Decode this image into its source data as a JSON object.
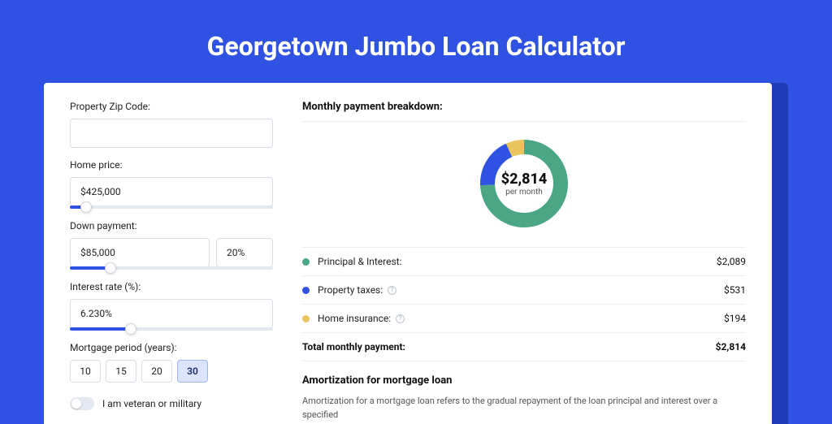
{
  "title": "Georgetown Jumbo Loan Calculator",
  "form": {
    "zip": {
      "label": "Property Zip Code:",
      "value": ""
    },
    "home_price": {
      "label": "Home price:",
      "value": "$425,000",
      "slider_pct": 8
    },
    "down_payment": {
      "label": "Down payment:",
      "amount": "$85,000",
      "percent": "20%",
      "slider_pct": 20
    },
    "interest_rate": {
      "label": "Interest rate (%):",
      "value": "6.230%",
      "slider_pct": 30
    },
    "period": {
      "label": "Mortgage period (years):",
      "options": [
        "10",
        "15",
        "20",
        "30"
      ],
      "active_index": 3
    },
    "veteran": {
      "label": "I am veteran or military",
      "checked": false
    }
  },
  "breakdown": {
    "title": "Monthly payment breakdown:",
    "donut_value": "$2,814",
    "donut_sub": "per month",
    "rows": [
      {
        "label": "Principal & Interest:",
        "amount": "$2,089",
        "color": "#4aa684",
        "info": false
      },
      {
        "label": "Property taxes:",
        "amount": "$531",
        "color": "#3052e3",
        "info": true
      },
      {
        "label": "Home insurance:",
        "amount": "$194",
        "color": "#e9c35b",
        "info": true
      }
    ],
    "total": {
      "label": "Total monthly payment:",
      "amount": "$2,814"
    }
  },
  "amort": {
    "title": "Amortization for mortgage loan",
    "text": "Amortization for a mortgage loan refers to the gradual repayment of the loan principal and interest over a specified"
  },
  "chart_data": {
    "type": "pie",
    "title": "Monthly payment breakdown",
    "series": [
      {
        "name": "Principal & Interest",
        "value": 2089,
        "color": "#4aa684"
      },
      {
        "name": "Property taxes",
        "value": 531,
        "color": "#3052e3"
      },
      {
        "name": "Home insurance",
        "value": 194,
        "color": "#e9c35b"
      }
    ],
    "total": 2814,
    "unit": "USD/month"
  }
}
